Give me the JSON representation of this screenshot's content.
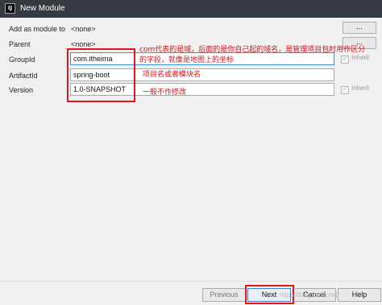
{
  "window": {
    "title": "New Module",
    "icon": "intellij-app-icon"
  },
  "form": {
    "add_as_module_to": {
      "label": "Add as module to",
      "value": "<none>",
      "button_label": "..."
    },
    "parent": {
      "label": "Parent",
      "value": "<none>",
      "button_label": "..."
    },
    "group_id": {
      "label": "GroupId",
      "value": "com.itheima",
      "inherit_label": "Inherit"
    },
    "artifact_id": {
      "label": "ArtifactId",
      "value": "spring-boot"
    },
    "version": {
      "label": "Version",
      "value": "1.0-SNAPSHOT",
      "inherit_label": "Inherit"
    }
  },
  "annotations": {
    "group_note_line1": "com代表的是域，后面的是你自己起的域名，是管理项目包时用作区分",
    "group_note_line2": "的字段，就像是地图上的坐标",
    "artifact_note": "项目名或者模块名",
    "version_note": "一般不作修改",
    "highlight_color": "#e0181c"
  },
  "buttons": {
    "previous": "Previous",
    "next": "Next",
    "cancel": "Cancel",
    "help": "Help"
  },
  "watermark": "https://blog.csdn.net/"
}
